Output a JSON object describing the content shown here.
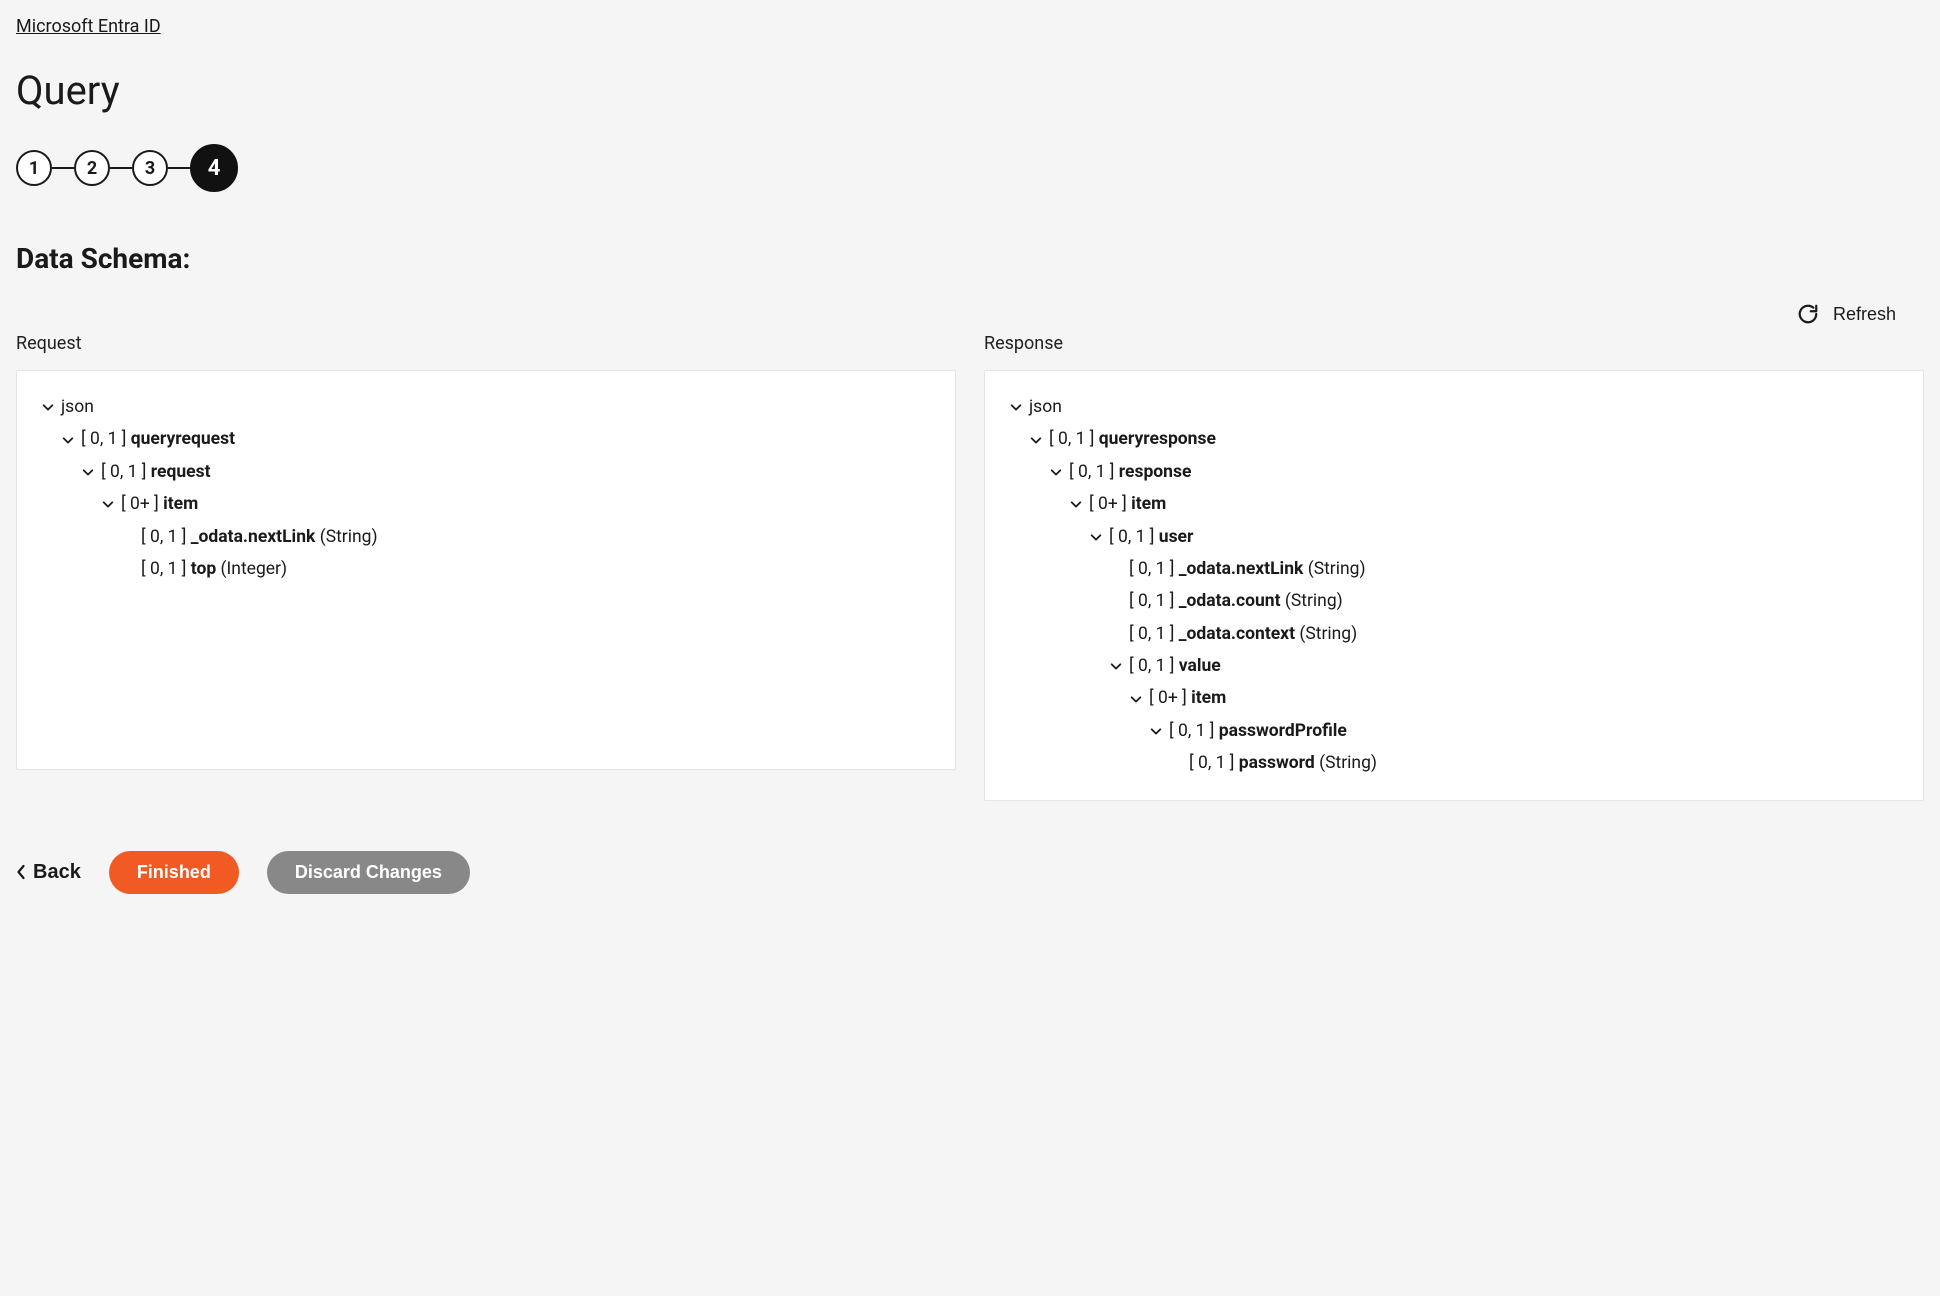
{
  "breadcrumb": {
    "label": "Microsoft Entra ID"
  },
  "page": {
    "title": "Query"
  },
  "stepper": {
    "steps": [
      "1",
      "2",
      "3",
      "4"
    ],
    "activeIndex": 3
  },
  "section": {
    "title": "Data Schema:"
  },
  "toolbar": {
    "refresh_label": "Refresh"
  },
  "schema": {
    "request": {
      "title": "Request",
      "root": "json",
      "rows": [
        {
          "indent": 1,
          "caret": true,
          "card": "[ 0, 1 ]",
          "name": "queryrequest",
          "type": ""
        },
        {
          "indent": 2,
          "caret": true,
          "card": "[ 0, 1 ]",
          "name": "request",
          "type": ""
        },
        {
          "indent": 3,
          "caret": true,
          "card": "[ 0+ ]",
          "name": "item",
          "type": ""
        },
        {
          "indent": 4,
          "caret": false,
          "card": "[ 0, 1 ]",
          "name": "_odata.nextLink",
          "type": "(String)"
        },
        {
          "indent": 4,
          "caret": false,
          "card": "[ 0, 1 ]",
          "name": "top",
          "type": "(Integer)"
        }
      ]
    },
    "response": {
      "title": "Response",
      "root": "json",
      "rows": [
        {
          "indent": 1,
          "caret": true,
          "card": "[ 0, 1 ]",
          "name": "queryresponse",
          "type": ""
        },
        {
          "indent": 2,
          "caret": true,
          "card": "[ 0, 1 ]",
          "name": "response",
          "type": ""
        },
        {
          "indent": 3,
          "caret": true,
          "card": "[ 0+ ]",
          "name": "item",
          "type": ""
        },
        {
          "indent": 4,
          "caret": true,
          "card": "[ 0, 1 ]",
          "name": "user",
          "type": ""
        },
        {
          "indent": 5,
          "caret": false,
          "card": "[ 0, 1 ]",
          "name": "_odata.nextLink",
          "type": "(String)"
        },
        {
          "indent": 5,
          "caret": false,
          "card": "[ 0, 1 ]",
          "name": "_odata.count",
          "type": "(String)"
        },
        {
          "indent": 5,
          "caret": false,
          "card": "[ 0, 1 ]",
          "name": "_odata.context",
          "type": "(String)"
        },
        {
          "indent": 5,
          "caret": true,
          "card": "[ 0, 1 ]",
          "name": "value",
          "type": ""
        },
        {
          "indent": 6,
          "caret": true,
          "card": "[ 0+ ]",
          "name": "item",
          "type": ""
        },
        {
          "indent": 7,
          "caret": true,
          "card": "[ 0, 1 ]",
          "name": "passwordProfile",
          "type": ""
        },
        {
          "indent": 8,
          "caret": false,
          "card": "[ 0, 1 ]",
          "name": "password",
          "type": "(String)"
        }
      ]
    }
  },
  "footer": {
    "back_label": "Back",
    "finished_label": "Finished",
    "discard_label": "Discard Changes"
  }
}
